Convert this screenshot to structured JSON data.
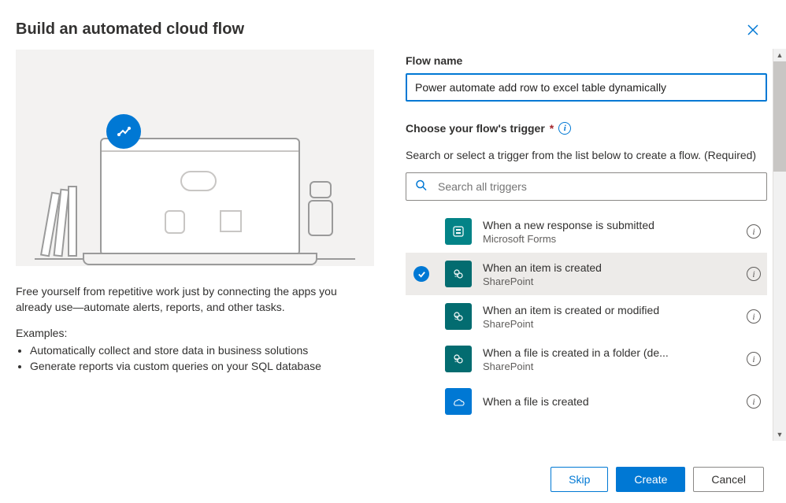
{
  "header": {
    "title": "Build an automated cloud flow"
  },
  "left": {
    "description": "Free yourself from repetitive work just by connecting the apps you already use—automate alerts, reports, and other tasks.",
    "examples_label": "Examples:",
    "examples": [
      "Automatically collect and store data in business solutions",
      "Generate reports via custom queries on your SQL database"
    ]
  },
  "right": {
    "flowname_label": "Flow name",
    "flowname_value": "Power automate add row to excel table dynamically",
    "trigger_label": "Choose your flow's trigger",
    "help_text": "Search or select a trigger from the list below to create a flow. (Required)",
    "search_placeholder": "Search all triggers",
    "triggers": [
      {
        "title": "When a new response is submitted",
        "service": "Microsoft Forms",
        "icon": "forms",
        "selected": false
      },
      {
        "title": "When an item is created",
        "service": "SharePoint",
        "icon": "sp",
        "selected": true
      },
      {
        "title": "When an item is created or modified",
        "service": "SharePoint",
        "icon": "sp",
        "selected": false
      },
      {
        "title": "When a file is created in a folder (de...",
        "service": "SharePoint",
        "icon": "sp",
        "selected": false
      },
      {
        "title": "When a file is created",
        "service": "",
        "icon": "od",
        "selected": false
      }
    ]
  },
  "footer": {
    "skip": "Skip",
    "create": "Create",
    "cancel": "Cancel"
  }
}
